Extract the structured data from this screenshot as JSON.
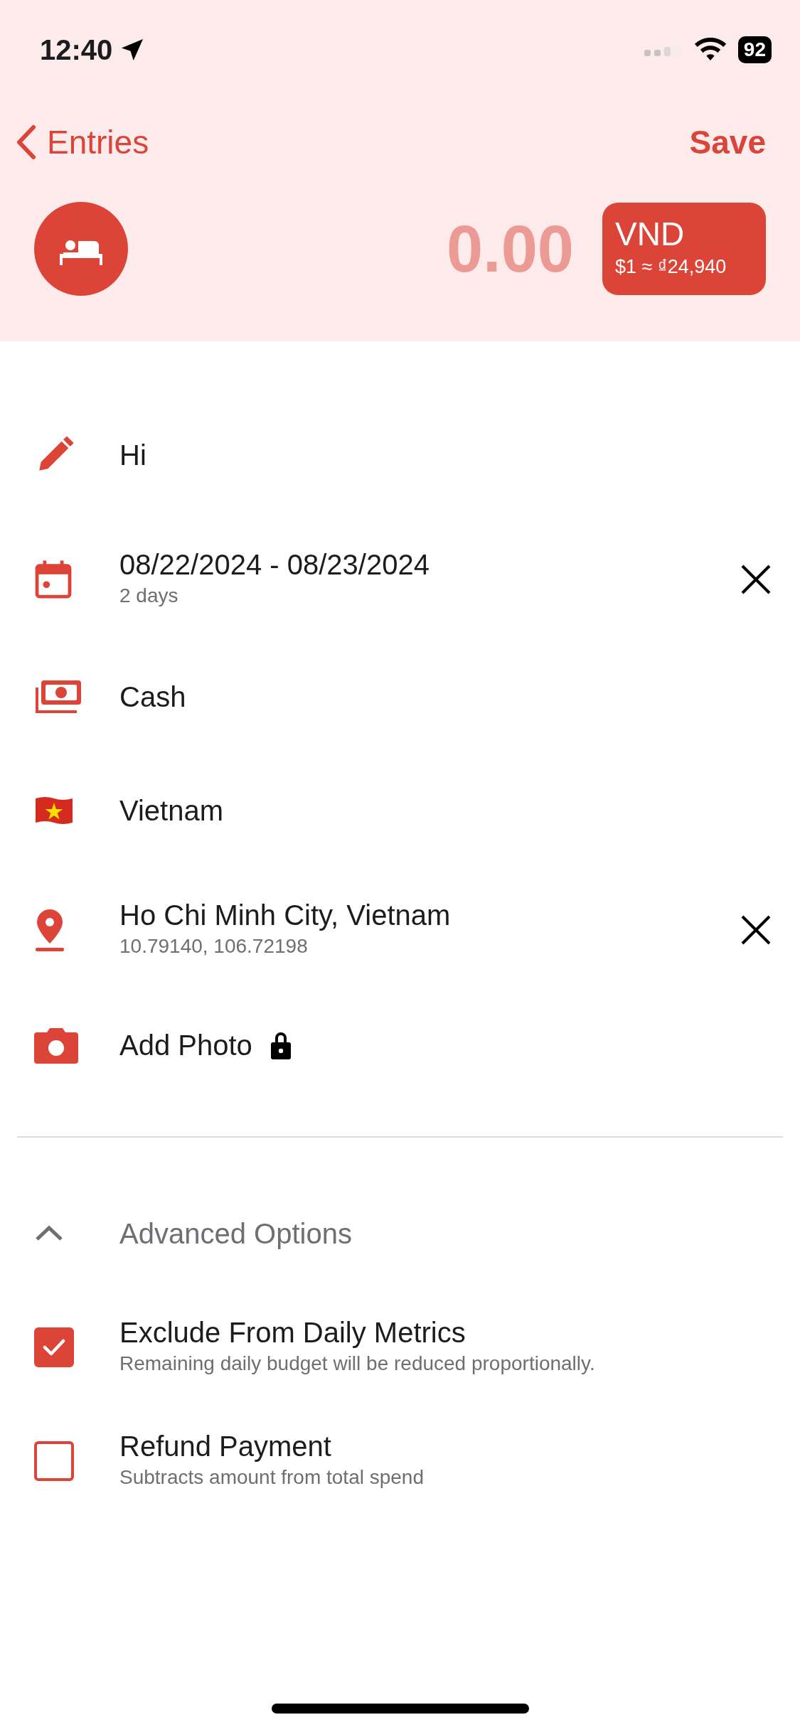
{
  "status_bar": {
    "time": "12:40",
    "battery": "92"
  },
  "nav": {
    "back": "Entries",
    "action": "Save"
  },
  "amount": {
    "value": "0.00",
    "currency": "VND",
    "rate": "$1 ≈ ₫24,940"
  },
  "rows": [
    {
      "kind": "name",
      "text": "Hi",
      "clear_button": false
    },
    {
      "kind": "date",
      "text": "08/22/2024 - 08/23/2024",
      "subtext": "2 days",
      "clear_button": true
    },
    {
      "kind": "payment",
      "text": "Cash",
      "clear_button": false
    },
    {
      "kind": "country",
      "text": "Vietnam",
      "clear_button": false
    },
    {
      "kind": "location",
      "text": "Ho Chi Minh City, Vietnam",
      "subtext": "10.79140, 106.72198",
      "clear_button": true
    },
    {
      "kind": "photo",
      "text": "Add Photo",
      "locked": true,
      "clear_button": false
    }
  ],
  "advanced": {
    "label": "Advanced Options",
    "expanded": true
  },
  "options": [
    {
      "label": "Exclude From Daily Metrics",
      "description": "Remaining daily budget will be reduced proportionally.",
      "checked": true
    },
    {
      "label": "Refund Payment",
      "description": "Subtracts amount from total spend",
      "checked": false
    }
  ]
}
